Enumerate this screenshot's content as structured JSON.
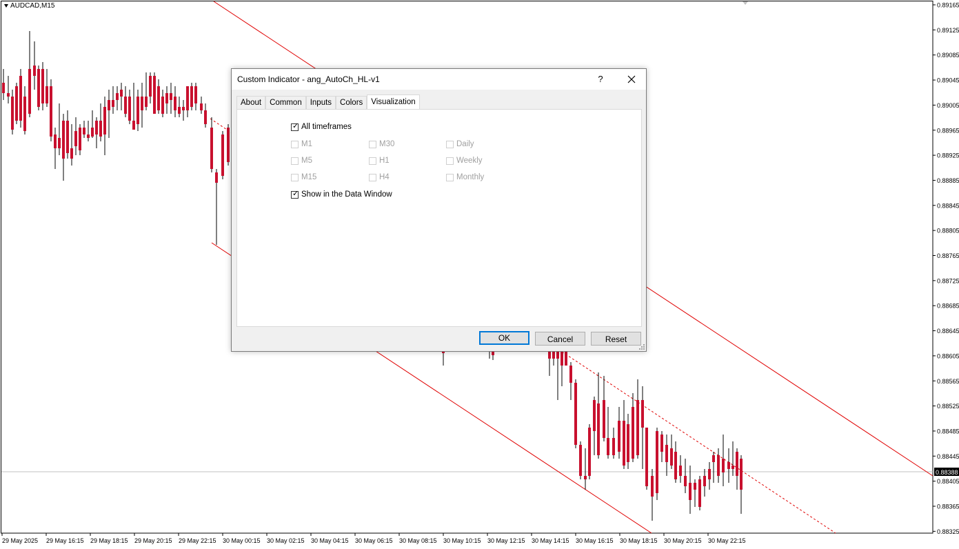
{
  "chart": {
    "symbol": "AUDCAD,M15",
    "current_price": "0.88388",
    "colors": {
      "bull": "#00008b",
      "bear": "#c8102e",
      "channel": "#e00000"
    },
    "price_ticks": [
      "0.89165",
      "0.89125",
      "0.89085",
      "0.89045",
      "0.89005",
      "0.88965",
      "0.88925",
      "0.88885",
      "0.88845",
      "0.88805",
      "0.88765",
      "0.88725",
      "0.88685",
      "0.88645",
      "0.88605",
      "0.88565",
      "0.88525",
      "0.88485",
      "0.88445",
      "0.88405",
      "0.88365",
      "0.88325"
    ],
    "time_ticks": [
      "29 May 2025",
      "29 May 16:15",
      "29 May 18:15",
      "29 May 20:15",
      "29 May 22:15",
      "30 May 00:15",
      "30 May 02:15",
      "30 May 04:15",
      "30 May 06:15",
      "30 May 08:15",
      "30 May 10:15",
      "30 May 12:15",
      "30 May 14:15",
      "30 May 16:15",
      "30 May 18:15",
      "30 May 20:15",
      "30 May 22:15"
    ]
  },
  "dialog": {
    "title": "Custom Indicator - ang_AutoCh_HL-v1",
    "help": "?",
    "tabs": [
      "About",
      "Common",
      "Inputs",
      "Colors",
      "Visualization"
    ],
    "active_tab": "Visualization",
    "all_timeframes": {
      "label": "All timeframes",
      "checked": true
    },
    "timeframes": [
      {
        "label": "M1"
      },
      {
        "label": "M30"
      },
      {
        "label": "Daily"
      },
      {
        "label": "M5"
      },
      {
        "label": "H1"
      },
      {
        "label": "Weekly"
      },
      {
        "label": "M15"
      },
      {
        "label": "H4"
      },
      {
        "label": "Monthly"
      }
    ],
    "show_data_window": {
      "label": "Show in the Data Window",
      "checked": true
    },
    "buttons": {
      "ok": "OK",
      "cancel": "Cancel",
      "reset": "Reset"
    }
  }
}
